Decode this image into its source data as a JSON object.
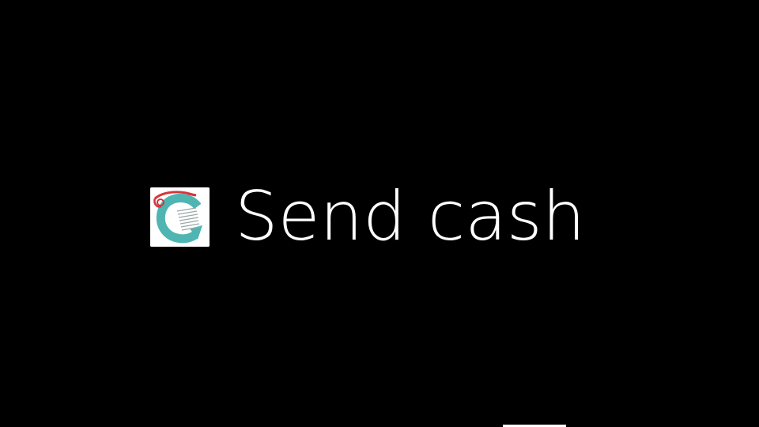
{
  "card": {
    "icon": "glass-coin-icon",
    "title": "Send cash"
  },
  "colors": {
    "background": "#000000",
    "text": "#ffffff",
    "icon_teal": "#4fb5b2",
    "icon_red": "#d9343a"
  },
  "timeline": {
    "indicator": "scroll-position-indicator"
  }
}
